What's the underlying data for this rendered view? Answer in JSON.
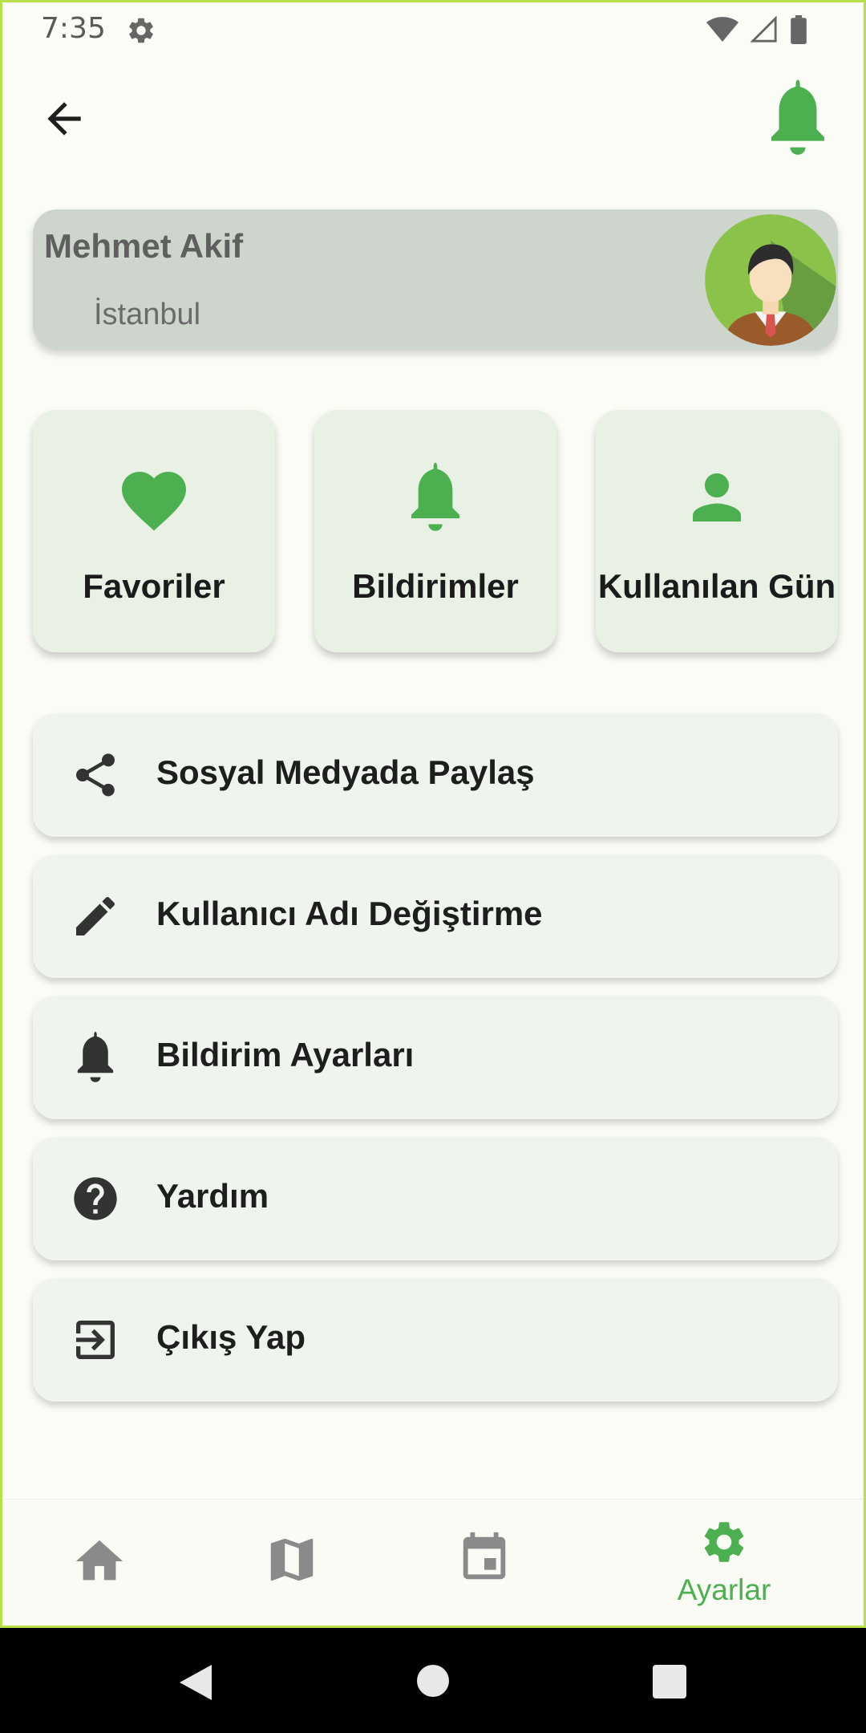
{
  "status_bar": {
    "time": "7:35",
    "icons": [
      "settings-icon",
      "wifi-icon",
      "signal-icon",
      "battery-icon"
    ]
  },
  "app_bar": {
    "back_icon": "arrow-back-icon",
    "notification_icon": "bell-icon"
  },
  "profile": {
    "name": "Mehmet Akif",
    "city": "İstanbul",
    "avatar": "user-avatar"
  },
  "tiles": [
    {
      "label": "Favoriler",
      "icon": "heart-icon"
    },
    {
      "label": "Bildirimler",
      "icon": "bell-icon"
    },
    {
      "label": "Kullanılan Gün",
      "icon": "person-icon"
    }
  ],
  "menu": [
    {
      "label": "Sosyal Medyada Paylaş",
      "icon": "share-icon"
    },
    {
      "label": "Kullanıcı Adı Değiştirme",
      "icon": "edit-icon"
    },
    {
      "label": "Bildirim Ayarları",
      "icon": "bell-icon"
    },
    {
      "label": "Yardım",
      "icon": "help-icon"
    },
    {
      "label": "Çıkış Yap",
      "icon": "logout-icon"
    }
  ],
  "bottom_nav": {
    "items": [
      {
        "icon": "home-icon",
        "label": ""
      },
      {
        "icon": "map-icon",
        "label": ""
      },
      {
        "icon": "calendar-icon",
        "label": ""
      },
      {
        "icon": "settings-icon",
        "label": "Ayarlar",
        "active": true
      }
    ]
  },
  "colors": {
    "accent": "#4caf50",
    "background": "#fcfcf7",
    "profile_card": "#cdd5cc",
    "tile": "#e8f1e3",
    "menu_item": "#eff4ee",
    "inactive_nav": "#8a8a8a"
  }
}
